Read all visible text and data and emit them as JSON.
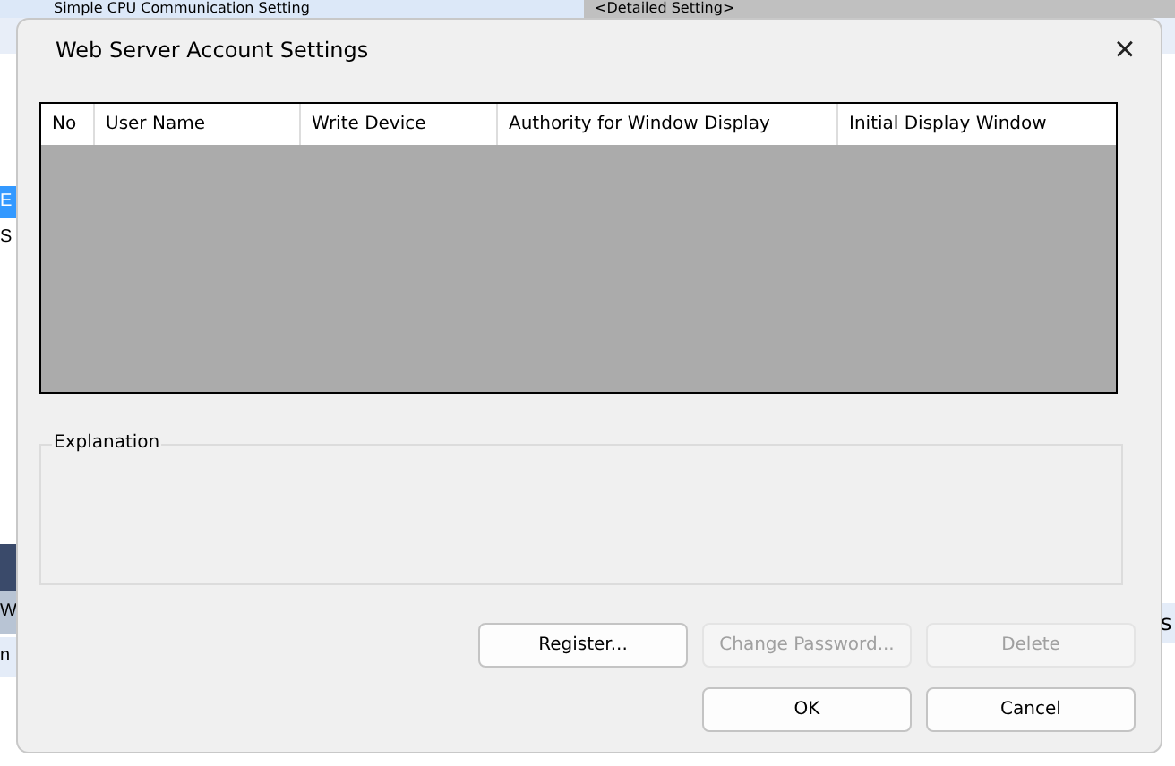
{
  "background": {
    "rows": [
      {
        "label": "Simple CPU Communication Setting",
        "value": "<Detailed Setting>"
      }
    ],
    "fragments": [
      {
        "text": "E",
        "kind": "selected"
      },
      {
        "text": "S",
        "kind": "plain"
      },
      {
        "text": "W",
        "kind": "tab"
      },
      {
        "text": "n",
        "kind": "item"
      }
    ],
    "right_fragment": "s"
  },
  "dialog": {
    "title": "Web Server Account Settings",
    "close": "×",
    "table": {
      "columns": [
        "No",
        "User Name",
        "Write Device",
        "Authority for Window Display",
        "Initial Display Window"
      ]
    },
    "explanation": {
      "label": "Explanation"
    },
    "buttons": [
      {
        "label": "Register...",
        "disabled": false
      },
      {
        "label": "Change Password...",
        "disabled": true
      },
      {
        "label": "Delete",
        "disabled": true
      },
      {
        "label": "OK",
        "disabled": false
      },
      {
        "label": "Cancel",
        "disabled": false
      }
    ]
  }
}
